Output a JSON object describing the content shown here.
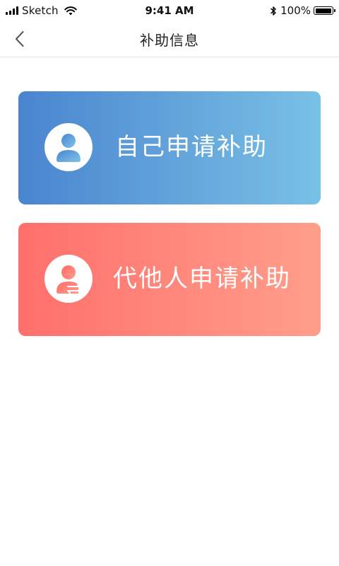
{
  "status_bar": {
    "carrier": "Sketch",
    "time": "9:41 AM",
    "battery": "100%",
    "battery_level": 1.0,
    "icons": [
      "signal-icon",
      "wifi-icon",
      "bluetooth-icon",
      "battery-icon"
    ]
  },
  "nav": {
    "title": "补助信息",
    "back_icon": "chevron-left-icon"
  },
  "cards": {
    "self": {
      "label": "自己申请补助",
      "icon": "person-icon",
      "colors": [
        "#4a84cf",
        "#79c1e6"
      ]
    },
    "other": {
      "label": "代他人申请补助",
      "icon": "person-transfer-icon",
      "colors": [
        "#ff6f6c",
        "#ff9e8b"
      ]
    }
  }
}
